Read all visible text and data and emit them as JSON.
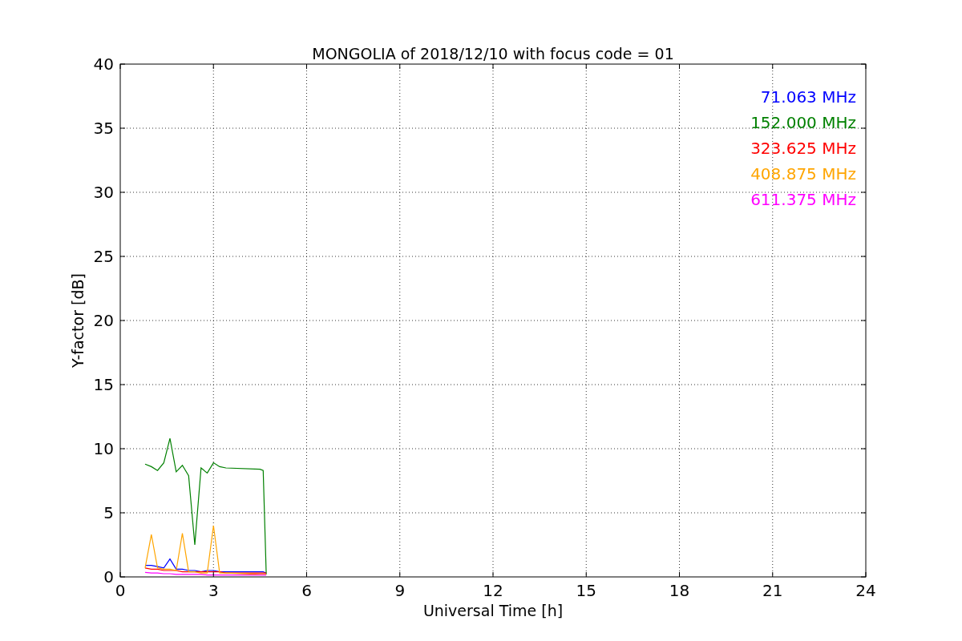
{
  "figure": {
    "chart_data": {
      "type": "line",
      "title": "MONGOLIA of 2018/12/10 with focus code = 01",
      "xlabel": "Universal Time [h]",
      "ylabel": "Y-factor [dB]",
      "x": [
        0.8,
        1.0,
        1.2,
        1.4,
        1.6,
        1.8,
        2.0,
        2.2,
        2.4,
        2.6,
        2.8,
        3.0,
        3.2,
        3.4,
        4.5,
        4.6,
        4.7
      ],
      "grid": true,
      "xlim": [
        0,
        24
      ],
      "ylim": [
        0,
        40
      ],
      "xticks": [
        0,
        3,
        6,
        9,
        12,
        15,
        18,
        21,
        24
      ],
      "yticks": [
        0,
        5,
        10,
        15,
        20,
        25,
        30,
        35,
        40
      ],
      "series": [
        {
          "name": "71.063 MHz",
          "color": "#0000ff",
          "values": [
            0.9,
            0.9,
            0.8,
            0.7,
            1.4,
            0.6,
            0.6,
            0.5,
            0.5,
            0.4,
            0.5,
            0.5,
            0.4,
            0.4,
            0.4,
            0.4,
            0.3
          ]
        },
        {
          "name": "152.000 MHz",
          "color": "#008000",
          "values": [
            8.8,
            8.6,
            8.3,
            8.9,
            10.8,
            8.2,
            8.7,
            7.9,
            2.5,
            8.5,
            8.1,
            8.9,
            8.6,
            8.5,
            8.4,
            8.3,
            0.2
          ]
        },
        {
          "name": "323.625 MHz",
          "color": "#ff0000",
          "values": [
            0.7,
            0.6,
            0.6,
            0.5,
            0.5,
            0.5,
            0.4,
            0.4,
            0.4,
            0.4,
            0.4,
            0.4,
            0.4,
            0.3,
            0.3,
            0.3,
            0.3
          ]
        },
        {
          "name": "408.875 MHz",
          "color": "#ffa500",
          "values": [
            0.7,
            3.3,
            0.7,
            0.6,
            0.6,
            0.5,
            3.4,
            0.4,
            0.4,
            0.3,
            0.3,
            4.0,
            0.3,
            0.3,
            0.2,
            0.2,
            0.2
          ]
        },
        {
          "name": "611.375 MHz",
          "color": "#ff00ff",
          "values": [
            0.35,
            0.3,
            0.3,
            0.25,
            0.25,
            0.2,
            0.2,
            0.2,
            0.2,
            0.2,
            0.15,
            0.15,
            0.15,
            0.15,
            0.15,
            0.15,
            0.15
          ]
        }
      ]
    }
  }
}
